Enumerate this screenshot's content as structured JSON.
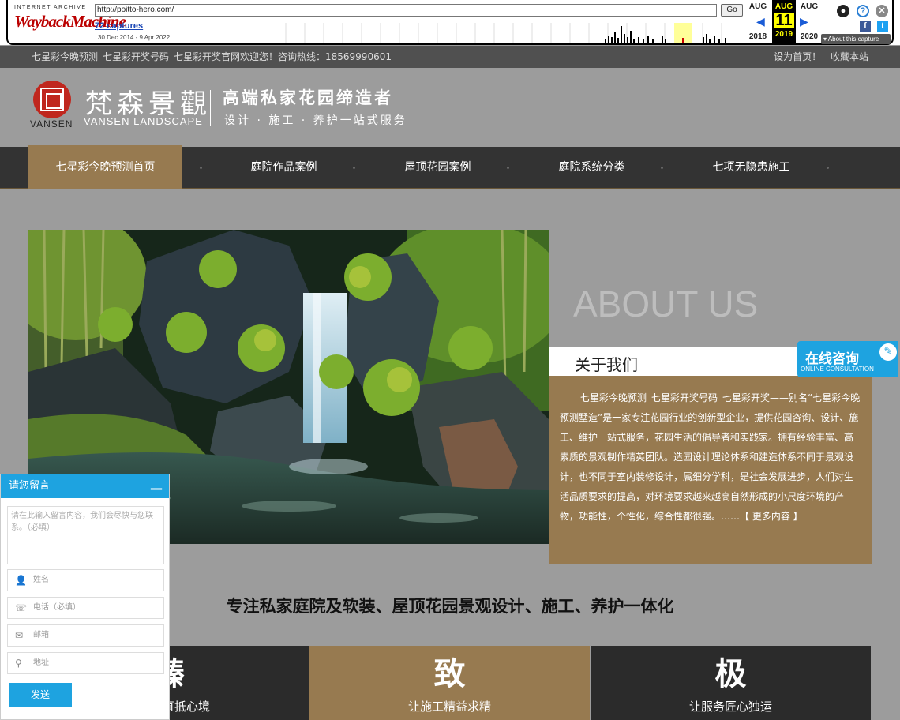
{
  "wayback": {
    "ia_label": "INTERNET ARCHIVE",
    "logo_text": "WaybackMachine",
    "url": "http://poitto-hero.com/",
    "go_label": "Go",
    "captures": "72 captures",
    "range": "30 Dec 2014 - 9 Apr 2022",
    "prev_month": "AUG",
    "prev_year": "2018",
    "cur_month": "AUG",
    "cur_day": "11",
    "cur_year": "2019",
    "next_month": "AUG",
    "next_year": "2020",
    "about_label": "About this capture"
  },
  "topbar": {
    "welcome": "七星彩今晚预测_七星彩开奖号码_七星彩开奖官网欢迎您！咨询热线：18569990601",
    "set_home": "设为首页！",
    "bookmark": "收藏本站"
  },
  "header": {
    "logo_en": "VANSEN",
    "logo_cn": "梵森景觀",
    "logo_sub": "VANSEN LANDSCAPE",
    "slogan1": "高端私家花园缔造者",
    "slogan2": "设计 · 施工 · 养护一站式服务"
  },
  "nav": {
    "items": [
      {
        "label": "七星彩今晚预测首页"
      },
      {
        "label": "庭院作品案例"
      },
      {
        "label": "屋顶花园案例"
      },
      {
        "label": "庭院系统分类"
      },
      {
        "label": "七项无隐患施工"
      }
    ]
  },
  "about": {
    "title_en": "ABOUT US",
    "title_cn": "关于我们",
    "body": "七星彩今晚预测_七星彩开奖号码_七星彩开奖——别名“七星彩今晚预测墅造”是一家专注花园行业的创新型企业，提供花园咨询、设计、施工、维护一站式服务，花园生活的倡导者和实践家。拥有经验丰富、高素质的景观制作精英团队。造园设计理论体系和建造体系不同于景观设计，也不同于室内装修设计，属细分学科，是社会发展进步，人们对生活品质要求的提高，对环境要求越来越高自然形成的小尺度环境的产物，功能性，个性化，综合性都很强。……",
    "more": "【 更多内容 】"
  },
  "consult": {
    "title": "在线咨询",
    "subtitle": "ONLINE CONSULTATION"
  },
  "tagline": "专注私家庭院及软装、屋顶花园景观设计、施工、养护一体化",
  "features": [
    {
      "big": "臻",
      "small": "让品质直抵心境"
    },
    {
      "big": "致",
      "small": "让施工精益求精"
    },
    {
      "big": "极",
      "small": "让服务匠心独运"
    }
  ],
  "message": {
    "title": "请您留言",
    "close": "—",
    "content_placeholder": "请在此输入留言内容，我们会尽快与您联系。（必填）",
    "name": "姓名",
    "phone": "电话（必填）",
    "email": "邮箱",
    "address": "地址",
    "send": "发送"
  },
  "colors": {
    "accent_brown": "#977a50",
    "nav_bg": "#333333",
    "consult_blue": "#1ea3e0",
    "page_bg": "#9c9c9c"
  }
}
